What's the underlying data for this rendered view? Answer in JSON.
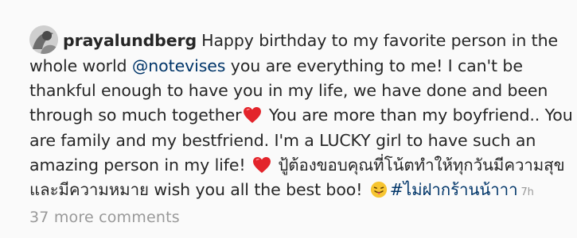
{
  "comment": {
    "username": "prayalundberg",
    "text_before_mention": "Happy birthday to my favorite person in the whole world ",
    "mention": "@notevises",
    "text_part1": " you are everything to me! I can't be thankful enough to have you in my life, we have done and been through so much together",
    "text_part2": " You are more than my boyfriend.. You are family and my bestfriend. I'm a LUCKY girl to have such an amazing person in my life! ",
    "text_part3": " ปู้ต้องขอบคุณที่โน้ตทำให้ทุกวันมีความสุข และมีความหมาย wish you all the best boo! ",
    "hashtag": "#ไม่ฝากร้านน้าาา",
    "time": "7h",
    "emojis": [
      "red-heart-icon",
      "red-heart-icon",
      "tongue-wink-face-icon"
    ]
  },
  "footer": {
    "more_comments_label": "37 more comments"
  },
  "colors": {
    "background": "#fafafa",
    "text": "#262626",
    "link": "#003569",
    "muted": "#999999",
    "heart": "#e3242b"
  }
}
